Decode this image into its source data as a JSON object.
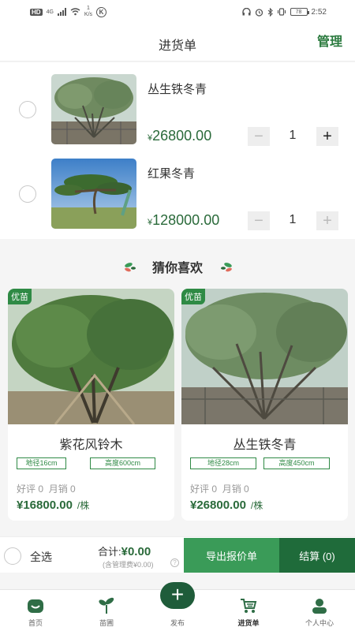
{
  "status_bar": {
    "network_tag": "HD",
    "signal_gen": "4G",
    "speed": "1\nK/s",
    "k_icon": "K",
    "battery": "78",
    "time": "2:52"
  },
  "header": {
    "title": "进货单",
    "manage_label": "管理"
  },
  "cart": {
    "items": [
      {
        "name": "丛生铁冬青",
        "currency": "¥",
        "price": "26800.00",
        "quantity": "1",
        "minus": "−",
        "plus": "+"
      },
      {
        "name": "红果冬青",
        "currency": "¥",
        "price": "128000.00",
        "quantity": "1",
        "minus": "−",
        "plus": "+"
      }
    ]
  },
  "recommend": {
    "title": "猜你喜欢",
    "cards": [
      {
        "badge": "优苗",
        "name": "紫花风铃木",
        "tags": [
          "地径16cm",
          "高度600cm"
        ],
        "reviews": "好评 0",
        "monthly_sales": "月销 0",
        "price": "¥16800.00",
        "unit": "/株"
      },
      {
        "badge": "优苗",
        "name": "丛生铁冬青",
        "tags": [
          "地径28cm",
          "高度450cm"
        ],
        "reviews": "好评 0",
        "monthly_sales": "月销 0",
        "price": "¥26800.00",
        "unit": "/株"
      }
    ]
  },
  "bottom_bar": {
    "select_all": "全选",
    "total_label": "合计:",
    "total_value": "¥0.00",
    "fee_note": "(含管理费¥0.00)",
    "fee_info": "?",
    "export_label": "导出报价单",
    "checkout_label": "结算 (0)"
  },
  "tabbar": {
    "tabs": [
      {
        "label": "首页",
        "icon": "home-icon"
      },
      {
        "label": "苗圃",
        "icon": "sprout-icon"
      },
      {
        "label": "发布",
        "icon": "plus-icon"
      },
      {
        "label": "进货单",
        "icon": "cart-icon"
      },
      {
        "label": "个人中心",
        "icon": "user-icon"
      }
    ],
    "publish_symbol": "+",
    "active": "进货单"
  },
  "colors": {
    "brand_green": "#2a7a3e",
    "export_button": "#3a9b58",
    "checkout_button": "#1f6b3a",
    "price_green": "#2a6a3a"
  }
}
